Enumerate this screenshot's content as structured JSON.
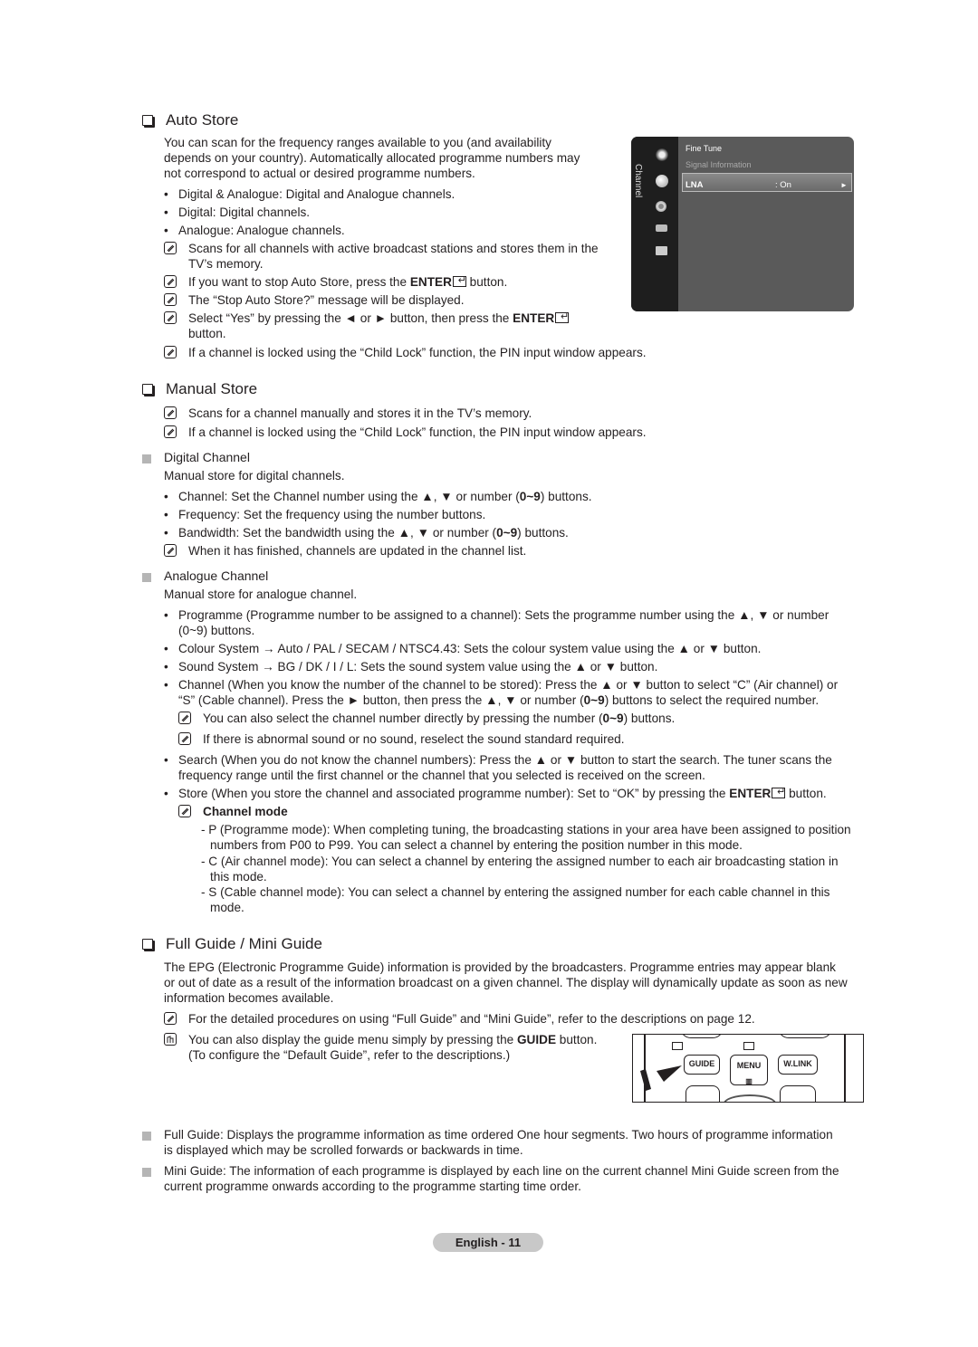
{
  "auto_store": {
    "title": "Auto Store",
    "intro": [
      "You can scan for the frequency ranges available to you (and availability",
      "depends on your country). Automatically allocated programme numbers may",
      "not correspond to actual or desired programme numbers."
    ],
    "bullets": [
      "Digital & Analogue: Digital and Analogue channels.",
      "Digital: Digital channels.",
      "Analogue: Analogue channels."
    ],
    "notes": [
      [
        "Scans for all channels with active broadcast stations and stores them in the",
        "TV’s memory."
      ],
      {
        "pre": "If you want to stop Auto Store, press the ",
        "bold": "ENTER",
        "post": " button."
      },
      "The “Stop Auto Store?” message will be displayed.",
      {
        "pre": "Select “Yes” by pressing the ◄ or ► button, then press the ",
        "bold": "ENTER",
        "line2": "button."
      },
      "If a channel is locked using the “Child Lock” function, the PIN input window appears."
    ]
  },
  "osd": {
    "side_label": "Channel",
    "items": [
      "Fine Tune",
      "Signal Information"
    ],
    "selected": {
      "label": "LNA",
      "value": ": On",
      "arrow": "►"
    },
    "icons": [
      "antenna-icon",
      "satellite-dish-icon",
      "gear-icon",
      "speaker-icon",
      "input-icon"
    ]
  },
  "manual_store": {
    "title": "Manual Store",
    "notes": [
      "Scans for a channel manually and stores it in the TV’s memory.",
      "If a channel is locked using the “Child Lock” function, the PIN input window appears."
    ],
    "digital": {
      "heading": "Digital Channel",
      "desc": "Manual store for digital channels.",
      "bullets": [
        {
          "pre": "Channel: Set the Channel number using the ▲, ▼ or number (",
          "bold": "0~9",
          "post": ") buttons."
        },
        {
          "pre": "Frequency: Set the frequency using the number buttons.",
          "bold": "",
          "post": ""
        },
        {
          "pre": "Bandwidth: Set the bandwidth using the ▲, ▼ or number (",
          "bold": "0~9",
          "post": ") buttons."
        }
      ],
      "note": "When it has finished, channels are updated in the channel list."
    },
    "analogue": {
      "heading": "Analogue Channel",
      "desc": "Manual store for analogue channel.",
      "b1": [
        "Programme (Programme number to be assigned to a channel): Sets the programme number using the ▲, ▼ or number",
        "(0~9) buttons."
      ],
      "b2": "Colour System → Auto / PAL / SECAM / NTSC4.43: Sets the colour system value using the ▲ or ▼ button.",
      "b3": "Sound System → BG / DK / I / L: Sets the sound system value using the ▲ or ▼ button.",
      "b4_l1": "Channel (When you know the number of the channel to be stored): Press the ▲ or ▼ button to select “C” (Air channel) or",
      "b4_l2": {
        "pre": "“S” (Cable channel). Press the ► button, then press the ▲, ▼ or number (",
        "bold": "0~9",
        "post": ") buttons to select the required number."
      },
      "note1": {
        "pre": "You can also select the channel number directly by pressing the number (",
        "bold": "0~9",
        "post": ") buttons."
      },
      "note2": "If there is abnormal sound or no sound, reselect the sound standard required.",
      "b5": [
        "Search (When you do not know the channel numbers): Press the ▲ or ▼ button to start the search. The tuner scans the",
        "frequency range until the first channel or the channel that you selected is received on the screen."
      ],
      "b6": {
        "pre": "Store (When you store the channel and associated programme number): Set to “OK” by pressing the ",
        "bold": "ENTER",
        "post": " button."
      },
      "channel_mode": {
        "label": "Channel mode",
        "items": [
          [
            "- P (Programme mode): When completing tuning, the broadcasting stations in your area have been assigned to position",
            "numbers from P00 to P99. You can select a channel by entering the position number in this mode."
          ],
          [
            "- C (Air channel mode): You can select a channel by entering the assigned number to each air broadcasting station in",
            "this mode."
          ],
          [
            "- S (Cable channel mode): You can select a channel by entering the assigned number for each cable channel in this",
            "mode."
          ]
        ]
      }
    }
  },
  "guide": {
    "title": "Full Guide / Mini Guide",
    "intro": [
      "The EPG (Electronic Programme Guide) information is provided by the broadcasters. Programme entries may appear blank",
      "or out of date as a result of the information broadcast on a given channel. The display will dynamically update as soon as new",
      "information becomes available."
    ],
    "note": "For the detailed procedures on using “Full Guide” and “Mini Guide”, refer to the descriptions on page 12.",
    "tip": {
      "pre": "You can also display the guide menu simply by pressing the ",
      "bold": "GUIDE",
      "post": " button.",
      "line2": "(To configure the “Default Guide”, refer to the descriptions.)"
    },
    "remote_buttons": [
      "GUIDE",
      "MENU",
      "W.LINK"
    ],
    "full": [
      "Full Guide: Displays the programme information as time ordered One hour segments. Two hours of programme information",
      "is displayed which may be scrolled forwards or backwards in time."
    ],
    "mini": [
      "Mini Guide: The information of each programme is displayed by each line on the current channel Mini Guide screen from the",
      "current programme onwards according to the programme starting time order."
    ]
  },
  "footer": {
    "page_label": "English - 11"
  }
}
